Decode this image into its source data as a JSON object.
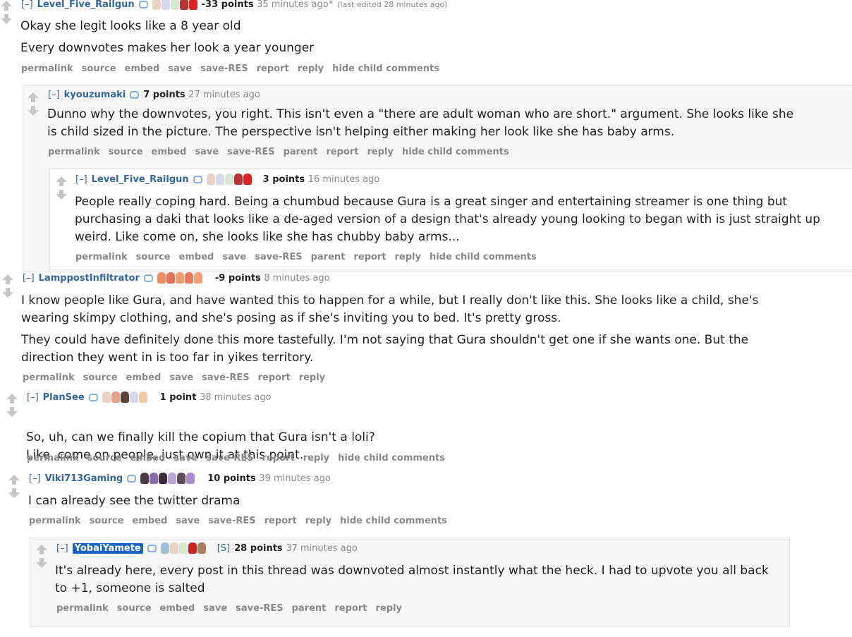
{
  "toggle": "[–]",
  "comments": [
    {
      "id": "c1",
      "author": "Level_Five_Railgun",
      "points": "-33 points",
      "time": "35 minutes ago*",
      "edited": "(last edited 28 minutes ago)",
      "paragraphs": [
        "Okay she legit looks like a 8 year old",
        "Every downvotes makes her look a year younger"
      ],
      "links": [
        "permalink",
        "source",
        "embed",
        "save",
        "save-RES",
        "report",
        "reply",
        "hide child comments"
      ]
    },
    {
      "id": "c2",
      "author": "kyouzumaki",
      "points": "7 points",
      "time": "27 minutes ago",
      "paragraphs": [
        "Dunno why the downvotes, you right. This isn't even a \"there are adult woman who are short.\" argument. She looks like she is child sized in the picture. The perspective isn't helping either making her look like she has baby arms."
      ],
      "links": [
        "permalink",
        "source",
        "embed",
        "save",
        "save-RES",
        "parent",
        "report",
        "reply",
        "hide child comments"
      ]
    },
    {
      "id": "c3",
      "author": "Level_Five_Railgun",
      "points": "3 points",
      "time": "16 minutes ago",
      "paragraphs": [
        "People really coping hard. Being a chumbud because Gura is a great singer and entertaining streamer is one thing but purchasing a daki that looks like a de-aged version of a design that's already young looking to began with is just straight up weird. Like come on, she looks like she has chubby baby arms..."
      ],
      "links": [
        "permalink",
        "source",
        "embed",
        "save",
        "save-RES",
        "parent",
        "report",
        "reply",
        "hide child comments"
      ]
    },
    {
      "id": "c4",
      "author": "LamppostInfiltrator",
      "points": "-9 points",
      "time": "8 minutes ago",
      "paragraphs": [
        "I know people like Gura, and have wanted this to happen for a while, but I really don't like this. She looks like a child, she's wearing skimpy clothing, and she's posing as if she's inviting you to bed. It's pretty gross.",
        "They could have definitely done this more tastefully. I'm not saying that Gura shouldn't get one if she wants one. But the direction they went in is too far in yikes territory."
      ],
      "links": [
        "permalink",
        "source",
        "embed",
        "save",
        "save-RES",
        "report",
        "reply"
      ]
    },
    {
      "id": "c5",
      "author": "PlanSee",
      "points": "1 point",
      "time": "38 minutes ago",
      "paragraphs": [
        "So, uh, can we finally kill the copium that Gura isn't a loli?\nLike, come on people, just own it at this point."
      ],
      "links": [
        "permalink",
        "source",
        "embed",
        "save",
        "save-RES",
        "report",
        "reply",
        "hide child comments"
      ]
    },
    {
      "id": "c6",
      "author": "Viki713Gaming",
      "points": "10 points",
      "time": "39 minutes ago",
      "paragraphs": [
        "I can already see the twitter drama"
      ],
      "links": [
        "permalink",
        "source",
        "embed",
        "save",
        "save-RES",
        "report",
        "reply",
        "hide child comments"
      ]
    },
    {
      "id": "c7",
      "author": "YobaiYamete",
      "submitter": "[S]",
      "points": "28 points",
      "time": "37 minutes ago",
      "paragraphs": [
        "It's already here, every post in this thread was downvoted almost instantly what the heck. I had to upvote you all back to +1, someone is salted"
      ],
      "links": [
        "permalink",
        "source",
        "embed",
        "save",
        "save-RES",
        "parent",
        "report",
        "reply"
      ]
    }
  ],
  "colors": {
    "link": "#336699",
    "meta": "#888888",
    "nested_bg": "#f7f7f8",
    "highlight": "#1b62c7"
  }
}
